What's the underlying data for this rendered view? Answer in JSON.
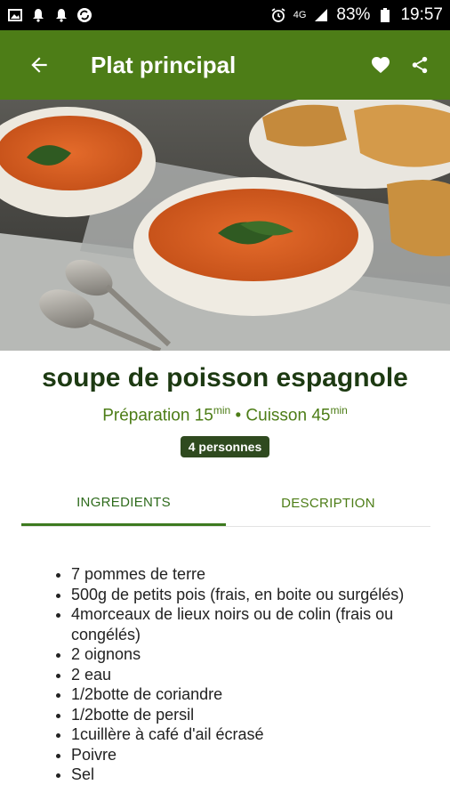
{
  "status_bar": {
    "battery": "83%",
    "time": "19:57",
    "network": "4G"
  },
  "app_bar": {
    "title": "Plat principal"
  },
  "recipe": {
    "title": "soupe de poisson espagnole",
    "prep_label": "Préparation 15",
    "prep_unit": "min",
    "separator": " • ",
    "cook_label": "Cuisson 45",
    "cook_unit": "min",
    "servings": "4 personnes"
  },
  "tabs": [
    {
      "label": "INGREDIENTS",
      "active": true
    },
    {
      "label": "DESCRIPTION",
      "active": false
    }
  ],
  "ingredients": [
    "7 pommes de terre",
    "500g de petits pois (frais, en boite ou surgélés)",
    "4morceaux de lieux noirs ou de colin (frais ou congélés)",
    "2 oignons",
    "2 eau",
    "1/2botte de coriandre",
    "1/2botte de persil",
    "1cuillère à café d'ail écrasé",
    "Poivre",
    "Sel"
  ],
  "colors": {
    "primary": "#4d7d17",
    "title": "#1d3a12",
    "badge": "#2f4a1f"
  }
}
